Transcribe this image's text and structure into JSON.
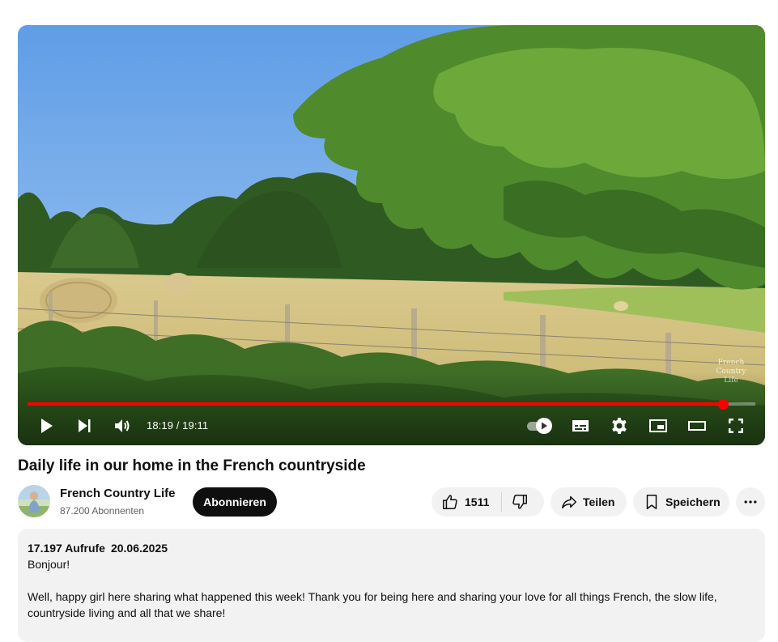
{
  "player": {
    "watermark": "French\nCountry\nLife",
    "progress_fraction": 0.955,
    "time_display": "18:19 / 19:11",
    "controls": {
      "play": "play-icon",
      "next": "next-icon",
      "volume": "volume-icon",
      "autoplay": "autoplay-toggle",
      "subtitles": "subtitles-icon",
      "settings": "gear-icon",
      "miniplayer": "miniplayer-icon",
      "theater": "theater-icon",
      "fullscreen": "fullscreen-icon"
    }
  },
  "video": {
    "title": "Daily life in our home in the French countryside"
  },
  "channel": {
    "name": "French Country Life",
    "subscribers": "87.200 Abonnenten",
    "subscribe_label": "Abonnieren"
  },
  "actions": {
    "like_count": "1511",
    "share_label": "Teilen",
    "save_label": "Speichern"
  },
  "description": {
    "views": "17.197 Aufrufe",
    "date": "20.06.2025",
    "lines": [
      "Bonjour!",
      "Well, happy girl here sharing what happened this week! Thank you for being here and sharing your love for all things French, the slow life,",
      "countryside living and all that we share!"
    ]
  },
  "colors": {
    "accent": "#ff0000",
    "pill_bg": "#f2f2f2",
    "subscribe_bg": "#0f0f0f"
  }
}
